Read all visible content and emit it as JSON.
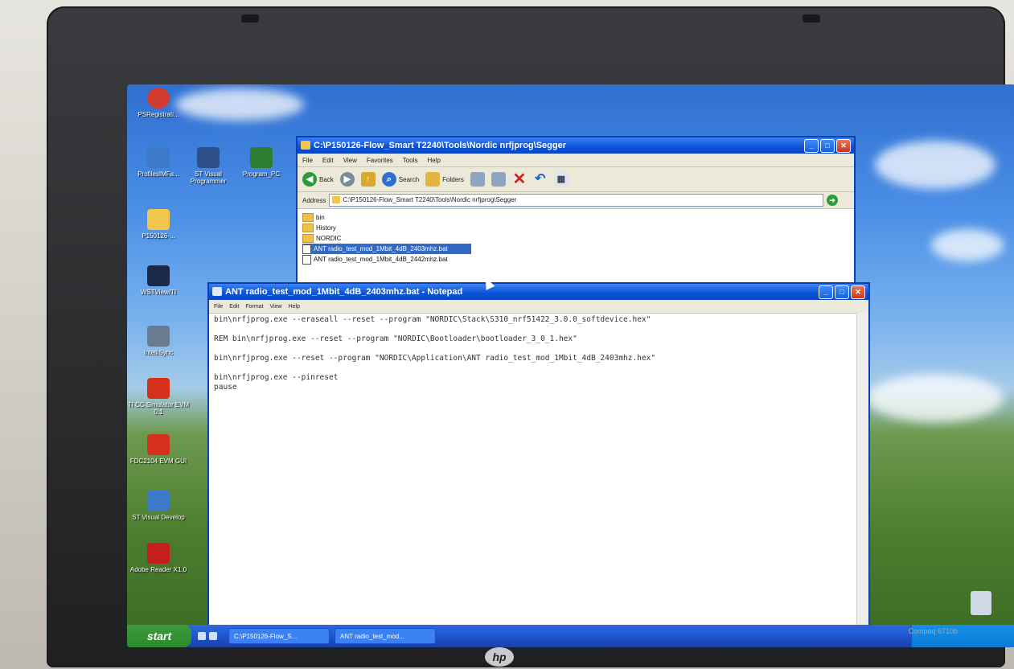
{
  "desktop": {
    "icons": [
      {
        "label": "PSRegistrati...",
        "color": "#d23c2e"
      },
      {
        "label": "ProfilesIMFa...",
        "color": "#3c79c8"
      },
      {
        "label": "ST Visual Programmer",
        "color": "#2d4f8a"
      },
      {
        "label": "Program_PC",
        "color": "#2e7d32"
      },
      {
        "label": "P150126-...",
        "color": "#f2c64b"
      },
      {
        "label": "WSTView/TI",
        "color": "#1b2a4a"
      },
      {
        "label": "IntelliSync",
        "color": "#6a7a90"
      },
      {
        "label": "TI CC Simulator EVM 0.1",
        "color": "#d4301c"
      },
      {
        "label": "FDC2104 EVM GUI",
        "color": "#d4301c"
      },
      {
        "label": "ST Visual Develop",
        "color": "#3c79c8"
      },
      {
        "label": "Adobe Reader X1.0",
        "color": "#c41e1e"
      }
    ]
  },
  "explorer": {
    "title": "C:\\P150126-Flow_Smart T2240\\Tools\\Nordic nrfjprog\\Segger",
    "menu": [
      "File",
      "Edit",
      "View",
      "Favorites",
      "Tools",
      "Help"
    ],
    "toolbar": {
      "back": "Back",
      "search": "Search",
      "folders": "Folders"
    },
    "address_label": "Address",
    "address_value": "C:\\P150126-Flow_Smart T2240\\Tools\\Nordic nrfjprog\\Segger",
    "files": [
      {
        "name": "bin",
        "type": "folder"
      },
      {
        "name": "History",
        "type": "folder"
      },
      {
        "name": "NORDIC",
        "type": "folder"
      },
      {
        "name": "ANT radio_test_mod_1Mbit_4dB_2403mhz.bat",
        "type": "bat",
        "selected": true
      },
      {
        "name": "ANT radio_test_mod_1Mbit_4dB_2442mhz.bat",
        "type": "bat"
      }
    ]
  },
  "notepad": {
    "title": "ANT radio_test_mod_1Mbit_4dB_2403mhz.bat - Notepad",
    "menu": [
      "File",
      "Edit",
      "Format",
      "View",
      "Help"
    ],
    "lines": [
      "bin\\nrfjprog.exe --eraseall --reset --program \"NORDIC\\Stack\\S310_nrf51422_3.0.0_softdevice.hex\"",
      "",
      "REM bin\\nrfjprog.exe --reset --program \"NORDIC\\Bootloader\\bootloader_3_0_1.hex\"",
      "",
      "bin\\nrfjprog.exe --reset --program \"NORDIC\\Application\\ANT radio_test_mod_1Mbit_4dB_2403mhz.hex\"",
      "",
      "bin\\nrfjprog.exe --pinreset",
      "pause"
    ]
  },
  "taskbar": {
    "start": "start",
    "tasks": [
      "C:\\P150126-Flow_S...",
      "ANT radio_test_mod..."
    ]
  },
  "laptop": {
    "logo": "hp",
    "model": "Compaq 6710b"
  }
}
